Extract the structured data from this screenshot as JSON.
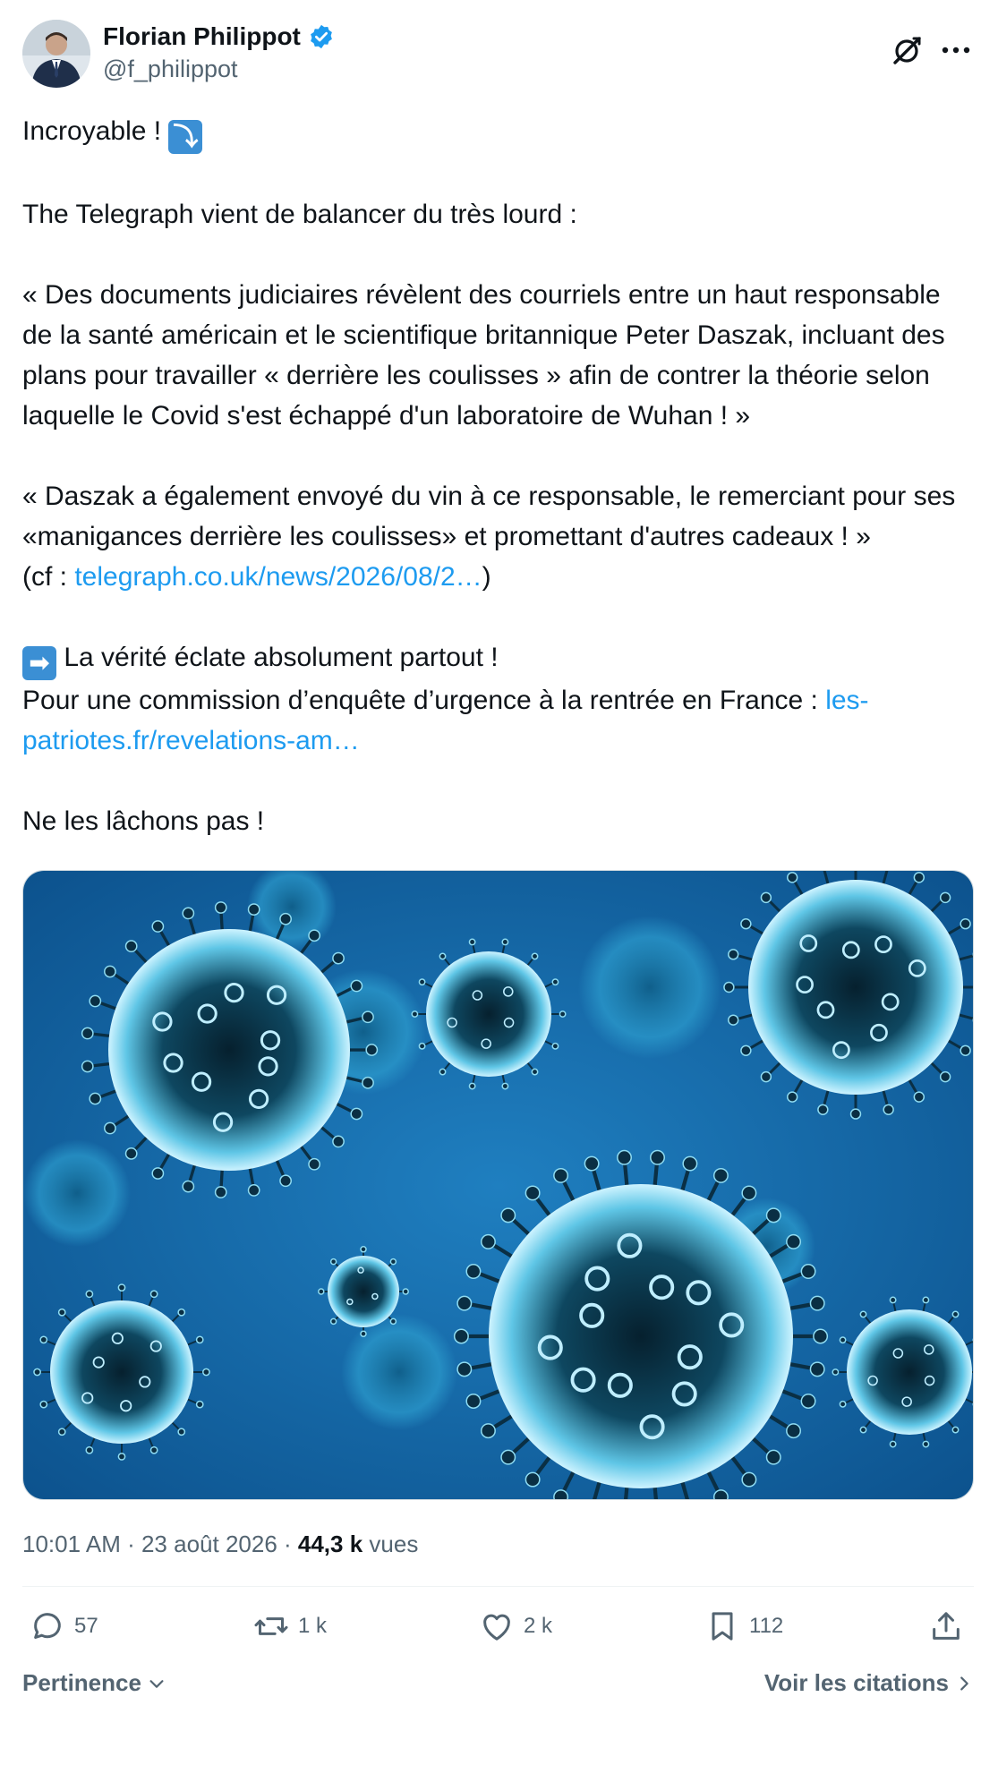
{
  "author": {
    "display_name": "Florian Philippot",
    "handle": "@f_philippot",
    "verified": true
  },
  "tweet": {
    "line1_text": "Incroyable ! ",
    "line1_emoji": "⤵",
    "p2": "The Telegraph vient de balancer du très lourd :",
    "p3": "« Des documents judiciaires révèlent des courriels entre un haut responsable de la santé américain et le scientifique britannique Peter Daszak, incluant des plans pour travailler « derrière les coulisses » afin de contrer la théorie selon laquelle le Covid s'est échappé d'un laboratoire de Wuhan ! »",
    "p4": "« Daszak a également envoyé du vin à ce responsable, le remerciant pour ses «manigances derrière les coulisses» et promettant d'autres cadeaux ! »",
    "cf_prefix": "(cf : ",
    "cf_link": "telegraph.co.uk/news/2026/08/2…",
    "cf_suffix": ")",
    "p6_emoji": "➡",
    "p6_text": " La vérité éclate absolument partout !",
    "p7_text": "Pour une commission d’enquête d’urgence à la rentrée en France : ",
    "p7_link": "les-patriotes.fr/revelations-am…",
    "p8": "Ne les lâchons pas !"
  },
  "meta": {
    "time": "10:01 AM",
    "sep1": " · ",
    "date": "23 août 2026",
    "sep2": " · ",
    "views_count": "44,3 k",
    "views_label": " vues"
  },
  "actions": {
    "replies": "57",
    "reposts": "1 k",
    "likes": "2 k",
    "bookmarks": "112"
  },
  "footer": {
    "sort_label": "Pertinence",
    "quotes_label": "Voir les citations"
  },
  "colors": {
    "link": "#1d9bf0",
    "secondary_text": "#536471",
    "primary_text": "#0f1419",
    "verified": "#1d9bf0"
  }
}
